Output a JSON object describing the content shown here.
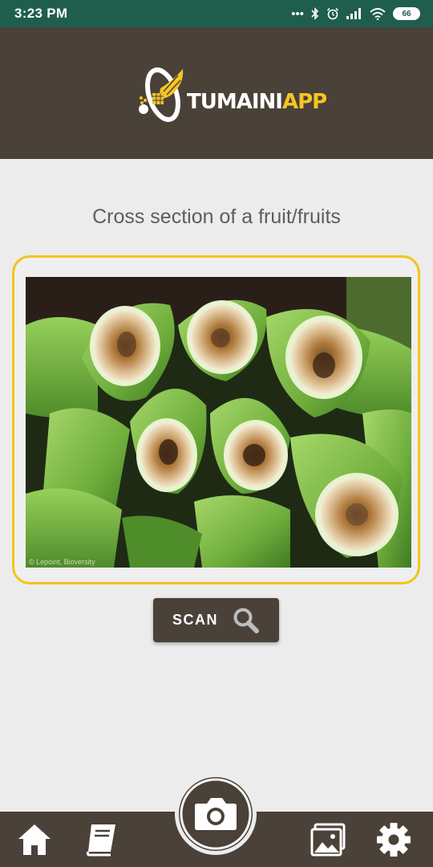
{
  "status_bar": {
    "time": "3:23 PM",
    "icons": [
      "more-dots-icon",
      "bluetooth-icon",
      "alarm-icon",
      "signal-icon",
      "wifi-icon",
      "battery-icon"
    ],
    "battery_level": "66"
  },
  "header": {
    "logo_text_white": "TUMAINI",
    "logo_text_yellow": "APP"
  },
  "main": {
    "title": "Cross section of a fruit/fruits",
    "image_credit": "© Lepoint, Bioversity",
    "scan_button": {
      "label": "SCAN",
      "icon": "search-icon"
    }
  },
  "bottom_nav": {
    "items": [
      {
        "icon": "home-icon"
      },
      {
        "icon": "book-icon"
      },
      {
        "icon": "camera-icon"
      },
      {
        "icon": "gallery-icon"
      },
      {
        "icon": "settings-icon"
      }
    ]
  },
  "colors": {
    "status_bar": "#1f5e4c",
    "header": "#4a4139",
    "accent": "#f2c418",
    "background": "#ececec"
  }
}
